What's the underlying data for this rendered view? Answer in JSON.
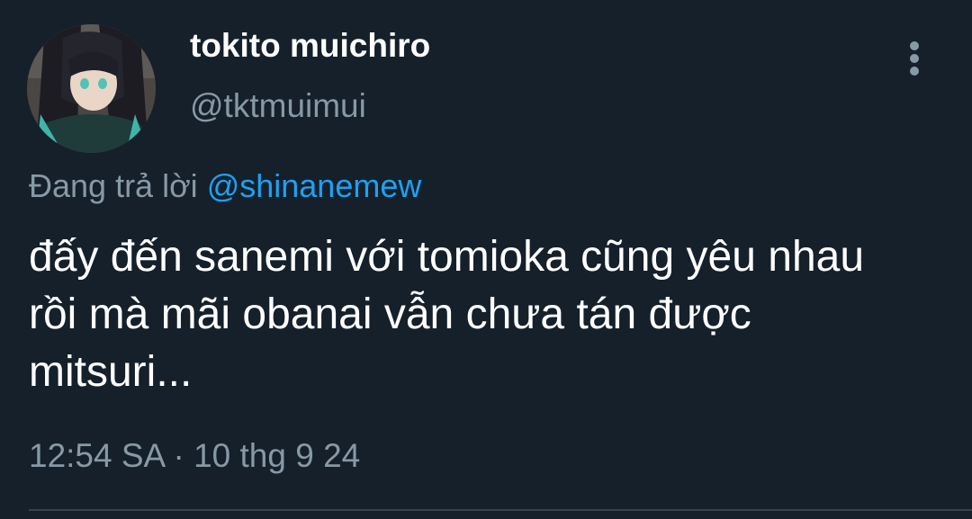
{
  "tweet": {
    "author": {
      "display_name": "tokito muichiro",
      "handle": "@tktmuimui",
      "avatar_icon": "avatar-image"
    },
    "more_icon": "more-vertical-icon",
    "reply_prefix": "Đang trả lời",
    "reply_to": "@shinanemew",
    "text_lines": [
      "đấy đến sanemi với tomioka cũng yêu nhau",
      "rồi mà mãi obanai vẫn chưa tán được",
      "mitsuri..."
    ],
    "timestamp": "12:54 SA · 10 thg 9 24"
  },
  "colors": {
    "background": "#15202b",
    "primary_text": "#ffffff",
    "secondary_text": "#8899a6",
    "link": "#1da1f2",
    "divider": "#38444d"
  }
}
